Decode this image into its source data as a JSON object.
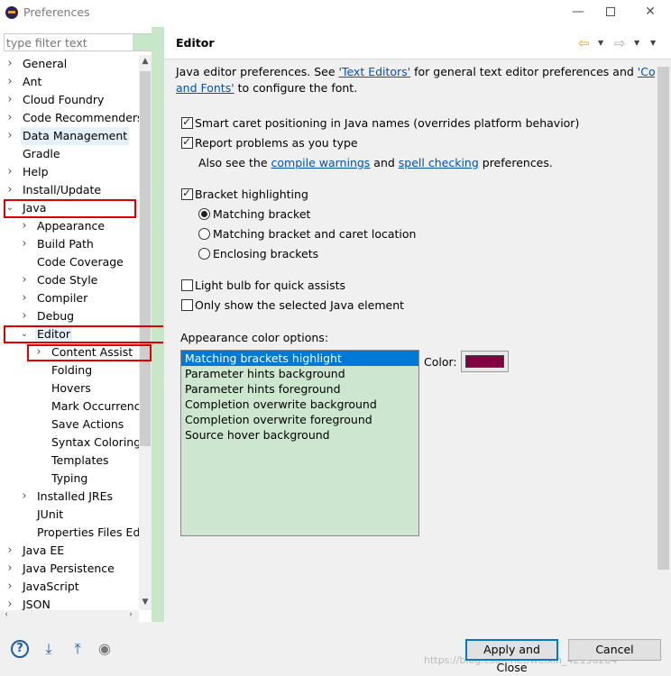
{
  "window": {
    "title": "Preferences",
    "minimize_glyph": "—",
    "close_glyph": "✕"
  },
  "filter": {
    "placeholder": "type filter text"
  },
  "tree": [
    {
      "label": "General",
      "level": 0,
      "twisty": "collapsed"
    },
    {
      "label": "Ant",
      "level": 0,
      "twisty": "collapsed"
    },
    {
      "label": "Cloud Foundry",
      "level": 0,
      "twisty": "collapsed"
    },
    {
      "label": "Code Recommenders",
      "level": 0,
      "twisty": "collapsed"
    },
    {
      "label": "Data Management",
      "level": 0,
      "twisty": "collapsed",
      "highlight": true
    },
    {
      "label": "Gradle",
      "level": 0,
      "twisty": "none"
    },
    {
      "label": "Help",
      "level": 0,
      "twisty": "collapsed"
    },
    {
      "label": "Install/Update",
      "level": 0,
      "twisty": "collapsed"
    },
    {
      "label": "Java",
      "level": 0,
      "twisty": "expanded"
    },
    {
      "label": "Appearance",
      "level": 1,
      "twisty": "collapsed"
    },
    {
      "label": "Build Path",
      "level": 1,
      "twisty": "collapsed"
    },
    {
      "label": "Code Coverage",
      "level": 1,
      "twisty": "none"
    },
    {
      "label": "Code Style",
      "level": 1,
      "twisty": "collapsed"
    },
    {
      "label": "Compiler",
      "level": 1,
      "twisty": "collapsed"
    },
    {
      "label": "Debug",
      "level": 1,
      "twisty": "collapsed"
    },
    {
      "label": "Editor",
      "level": 1,
      "twisty": "expanded",
      "selected": true
    },
    {
      "label": "Content Assist",
      "level": 2,
      "twisty": "collapsed"
    },
    {
      "label": "Folding",
      "level": 2,
      "twisty": "none"
    },
    {
      "label": "Hovers",
      "level": 2,
      "twisty": "none"
    },
    {
      "label": "Mark Occurrences",
      "level": 2,
      "twisty": "none"
    },
    {
      "label": "Save Actions",
      "level": 2,
      "twisty": "none"
    },
    {
      "label": "Syntax Coloring",
      "level": 2,
      "twisty": "none"
    },
    {
      "label": "Templates",
      "level": 2,
      "twisty": "none"
    },
    {
      "label": "Typing",
      "level": 2,
      "twisty": "none"
    },
    {
      "label": "Installed JREs",
      "level": 1,
      "twisty": "collapsed"
    },
    {
      "label": "JUnit",
      "level": 1,
      "twisty": "none"
    },
    {
      "label": "Properties Files Editor",
      "level": 1,
      "twisty": "none"
    },
    {
      "label": "Java EE",
      "level": 0,
      "twisty": "collapsed"
    },
    {
      "label": "Java Persistence",
      "level": 0,
      "twisty": "collapsed"
    },
    {
      "label": "JavaScript",
      "level": 0,
      "twisty": "collapsed"
    },
    {
      "label": "JSON",
      "level": 0,
      "twisty": "collapsed"
    }
  ],
  "page": {
    "title": "Editor",
    "intro_1": "Java editor preferences. See ",
    "intro_link_1": "'Text Editors'",
    "intro_2": " for general text editor preferences and ",
    "intro_link_2a": "'Colors",
    "intro_link_2b": "and Fonts'",
    "intro_3": " to configure the font.",
    "opt_smart_caret": "Smart caret positioning in Java names (overrides platform behavior)",
    "opt_report_problems": "Report problems as you type",
    "also_see_1": "Also see the ",
    "also_see_link_1": "compile warnings",
    "also_see_2": " and ",
    "also_see_link_2": "spell checking",
    "also_see_3": " preferences.",
    "opt_bracket": "Bracket highlighting",
    "radio_matching": "Matching bracket",
    "radio_matching_caret": "Matching bracket and caret location",
    "radio_enclosing": "Enclosing brackets",
    "opt_light_bulb": "Light bulb for quick assists",
    "opt_only_selected": "Only show the selected Java element",
    "color_options_label": "Appearance color options:",
    "color_items": [
      "Matching brackets highlight",
      "Parameter hints background",
      "Parameter hints foreground",
      "Completion overwrite background",
      "Completion overwrite foreground",
      "Source hover background"
    ],
    "color_label": "Color:",
    "swatch_color": "#800040"
  },
  "buttons": {
    "apply_close": "Apply and Close",
    "cancel": "Cancel"
  },
  "watermark": "https://blog.csdn.net/weixin_42156284",
  "icons": [
    "help-icon",
    "import-icon",
    "export-icon",
    "record-icon",
    "back-arrow-icon",
    "forward-arrow-icon",
    "view-menu-icon"
  ]
}
